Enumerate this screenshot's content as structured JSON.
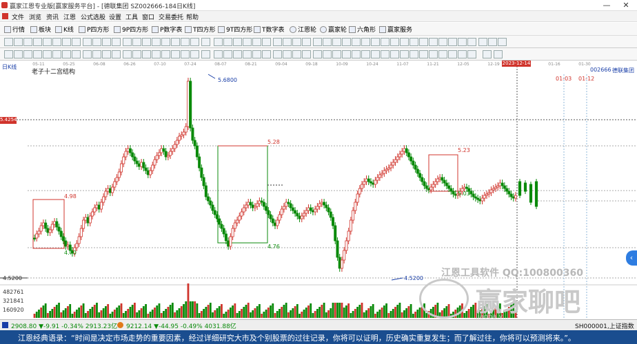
{
  "window": {
    "title": "赢家江恩专业版[赢家服务平台] - [德联集团  SZ002666-184日K线]",
    "minimize": "—",
    "close": "✕"
  },
  "menu": [
    "文件",
    "浏览",
    "资讯",
    "江恩",
    "公式选股",
    "设置",
    "工具",
    "窗口",
    "交易委托",
    "帮助"
  ],
  "toolbar1": [
    "行情",
    "板块",
    "K线",
    "P四方形",
    "9P四方形",
    "P数字表",
    "T四方形",
    "9T四方形",
    "T数字表",
    "江恩轮",
    "赢家轮",
    "六角形",
    "赢家服务"
  ],
  "chart": {
    "period_label": "日K线",
    "stock_code": "002666",
    "stock_name": "德联集团",
    "study_title": "老子十二宫结构",
    "cursor_date": "2023-12-14",
    "cursor_price": "5.4254",
    "future_dates": [
      "01-03",
      "01-12"
    ],
    "price_labels": {
      "high": "5.6800",
      "low": "4.5200",
      "box1_top": "4.98",
      "box1_bottom": "4.70",
      "box2_top": "5.28",
      "box2_bottom": "4.76",
      "box3_top": "5.23",
      "box3_bottom": "5.03"
    },
    "y_axis_price": "4.5200",
    "volume_ticks": [
      "482761",
      "321841",
      "160920"
    ],
    "dates": [
      "05-11",
      "05-25",
      "06-08",
      "06-26",
      "07-10",
      "07-24",
      "08-07",
      "08-21",
      "09-04",
      "09-18",
      "10-09",
      "10-24",
      "11-07",
      "11-21",
      "12-05",
      "12-19",
      "01-02",
      "01-16",
      "01-30"
    ]
  },
  "chart_data": {
    "type": "candlestick",
    "title": "老子十二宫结构",
    "xlabel": "",
    "ylabel": "",
    "ylim": [
      4.45,
      5.75
    ],
    "high": 5.68,
    "low": 4.52
  },
  "status": {
    "index1": "2908.80 ▼-9.91 -0.34% 2913.23亿",
    "index2": "9212.14 ▼-44.95 -0.49% 4031.88亿",
    "right": "SH000001,上证指数"
  },
  "watermark": {
    "text1": "江恩工具软件  QQ:100800360",
    "text2": "赢家聊吧",
    "text3": "liaoba.v..."
  },
  "quote": "江恩经典语录：“时间是决定市场走势的重要因素，经过详细研究大市及个别股票的过往记录，你将可以证明，历史确实重复发生；而了解过往，你将可以预测将来。”。"
}
